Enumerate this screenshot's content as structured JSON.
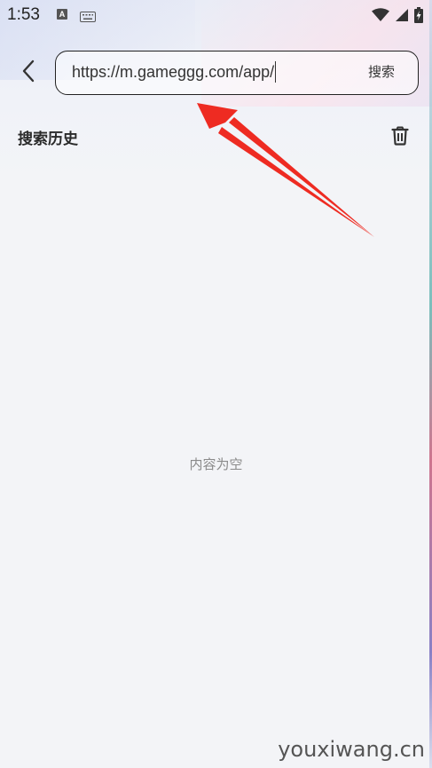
{
  "status_bar": {
    "time": "1:53",
    "left_icons": [
      "text-a-icon",
      "keyboard-icon"
    ],
    "right_icons": [
      "wifi-icon",
      "signal-icon",
      "battery-charging-icon"
    ]
  },
  "header": {
    "back_icon": "chevron-left-icon",
    "search_input_value": "https://m.gameggg.com/app/",
    "search_button_label": "搜索"
  },
  "history": {
    "title": "搜索历史",
    "clear_icon": "trash-icon"
  },
  "empty_state": {
    "text": "内容为空"
  },
  "annotation": {
    "color": "#ee2b22",
    "icon": "red-arrow"
  },
  "watermark": {
    "text": "youxiwang.cn"
  }
}
